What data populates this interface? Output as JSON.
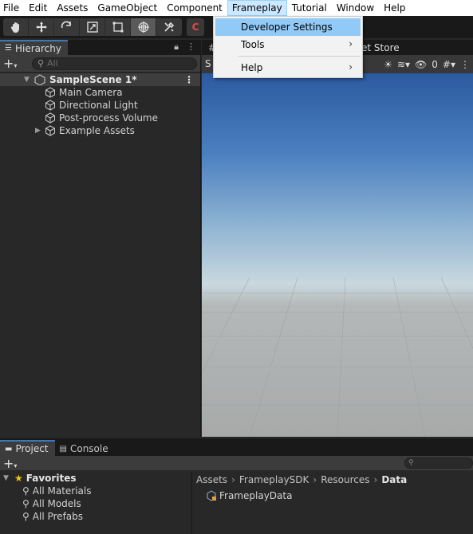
{
  "menubar": {
    "items": [
      "File",
      "Edit",
      "Assets",
      "GameObject",
      "Component",
      "Frameplay",
      "Tutorial",
      "Window",
      "Help"
    ],
    "active_index": 5
  },
  "dropdown": {
    "items": [
      {
        "label": "Developer Settings",
        "highlighted": true,
        "submenu": false
      },
      {
        "label": "Tools",
        "highlighted": false,
        "submenu": true
      },
      {
        "label": "Help",
        "highlighted": false,
        "submenu": true
      }
    ]
  },
  "toolbar": {
    "tools": [
      "hand-icon",
      "move-icon",
      "rotate-icon",
      "scale-icon",
      "rect-icon",
      "transform-icon",
      "custom-tool-icon"
    ],
    "selected_tool": "transform-icon",
    "extra_label": "C"
  },
  "hierarchy": {
    "tab_label": "Hierarchy",
    "search_placeholder": "All",
    "scene_name": "SampleScene 1*",
    "items": [
      {
        "label": "Main Camera",
        "has_children": false
      },
      {
        "label": "Directional Light",
        "has_children": false
      },
      {
        "label": "Post-process Volume",
        "has_children": false
      },
      {
        "label": "Example Assets",
        "has_children": true
      }
    ]
  },
  "scene_view": {
    "tabs": [
      "#",
      "et Store"
    ],
    "toolbar_letter": "S",
    "hidden_count": "0",
    "sky_color": "#2c5aa0",
    "ground_color": "#a8aaaa"
  },
  "bottom": {
    "tabs": [
      "Project",
      "Console"
    ],
    "favorites_label": "Favorites",
    "favorites": [
      "All Materials",
      "All Models",
      "All Prefabs"
    ],
    "breadcrumb": [
      "Assets",
      "FrameplaySDK",
      "Resources",
      "Data"
    ],
    "assets": [
      "FrameplayData"
    ]
  },
  "colors": {
    "accent": "#3a79bb",
    "menu_highlight": "#91c9f7",
    "menubar_bg": "#ffffff"
  }
}
